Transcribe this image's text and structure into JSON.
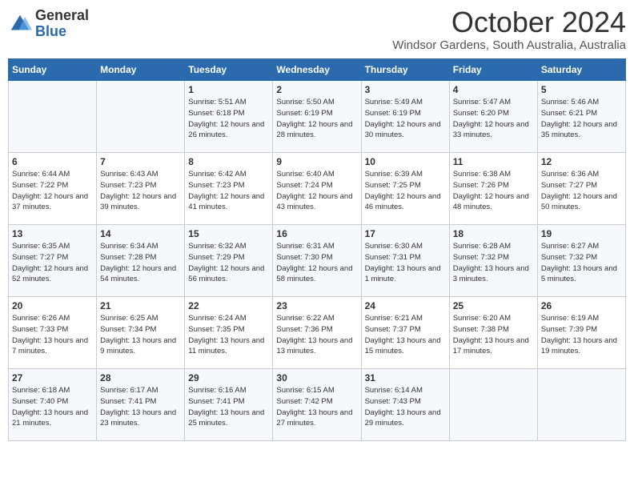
{
  "header": {
    "logo_general": "General",
    "logo_blue": "Blue",
    "month_title": "October 2024",
    "location": "Windsor Gardens, South Australia, Australia"
  },
  "weekdays": [
    "Sunday",
    "Monday",
    "Tuesday",
    "Wednesday",
    "Thursday",
    "Friday",
    "Saturday"
  ],
  "weeks": [
    [
      {
        "day": "",
        "info": ""
      },
      {
        "day": "",
        "info": ""
      },
      {
        "day": "1",
        "info": "Sunrise: 5:51 AM\nSunset: 6:18 PM\nDaylight: 12 hours and 26 minutes."
      },
      {
        "day": "2",
        "info": "Sunrise: 5:50 AM\nSunset: 6:19 PM\nDaylight: 12 hours and 28 minutes."
      },
      {
        "day": "3",
        "info": "Sunrise: 5:49 AM\nSunset: 6:19 PM\nDaylight: 12 hours and 30 minutes."
      },
      {
        "day": "4",
        "info": "Sunrise: 5:47 AM\nSunset: 6:20 PM\nDaylight: 12 hours and 33 minutes."
      },
      {
        "day": "5",
        "info": "Sunrise: 5:46 AM\nSunset: 6:21 PM\nDaylight: 12 hours and 35 minutes."
      }
    ],
    [
      {
        "day": "6",
        "info": "Sunrise: 6:44 AM\nSunset: 7:22 PM\nDaylight: 12 hours and 37 minutes."
      },
      {
        "day": "7",
        "info": "Sunrise: 6:43 AM\nSunset: 7:23 PM\nDaylight: 12 hours and 39 minutes."
      },
      {
        "day": "8",
        "info": "Sunrise: 6:42 AM\nSunset: 7:23 PM\nDaylight: 12 hours and 41 minutes."
      },
      {
        "day": "9",
        "info": "Sunrise: 6:40 AM\nSunset: 7:24 PM\nDaylight: 12 hours and 43 minutes."
      },
      {
        "day": "10",
        "info": "Sunrise: 6:39 AM\nSunset: 7:25 PM\nDaylight: 12 hours and 46 minutes."
      },
      {
        "day": "11",
        "info": "Sunrise: 6:38 AM\nSunset: 7:26 PM\nDaylight: 12 hours and 48 minutes."
      },
      {
        "day": "12",
        "info": "Sunrise: 6:36 AM\nSunset: 7:27 PM\nDaylight: 12 hours and 50 minutes."
      }
    ],
    [
      {
        "day": "13",
        "info": "Sunrise: 6:35 AM\nSunset: 7:27 PM\nDaylight: 12 hours and 52 minutes."
      },
      {
        "day": "14",
        "info": "Sunrise: 6:34 AM\nSunset: 7:28 PM\nDaylight: 12 hours and 54 minutes."
      },
      {
        "day": "15",
        "info": "Sunrise: 6:32 AM\nSunset: 7:29 PM\nDaylight: 12 hours and 56 minutes."
      },
      {
        "day": "16",
        "info": "Sunrise: 6:31 AM\nSunset: 7:30 PM\nDaylight: 12 hours and 58 minutes."
      },
      {
        "day": "17",
        "info": "Sunrise: 6:30 AM\nSunset: 7:31 PM\nDaylight: 13 hours and 1 minute."
      },
      {
        "day": "18",
        "info": "Sunrise: 6:28 AM\nSunset: 7:32 PM\nDaylight: 13 hours and 3 minutes."
      },
      {
        "day": "19",
        "info": "Sunrise: 6:27 AM\nSunset: 7:32 PM\nDaylight: 13 hours and 5 minutes."
      }
    ],
    [
      {
        "day": "20",
        "info": "Sunrise: 6:26 AM\nSunset: 7:33 PM\nDaylight: 13 hours and 7 minutes."
      },
      {
        "day": "21",
        "info": "Sunrise: 6:25 AM\nSunset: 7:34 PM\nDaylight: 13 hours and 9 minutes."
      },
      {
        "day": "22",
        "info": "Sunrise: 6:24 AM\nSunset: 7:35 PM\nDaylight: 13 hours and 11 minutes."
      },
      {
        "day": "23",
        "info": "Sunrise: 6:22 AM\nSunset: 7:36 PM\nDaylight: 13 hours and 13 minutes."
      },
      {
        "day": "24",
        "info": "Sunrise: 6:21 AM\nSunset: 7:37 PM\nDaylight: 13 hours and 15 minutes."
      },
      {
        "day": "25",
        "info": "Sunrise: 6:20 AM\nSunset: 7:38 PM\nDaylight: 13 hours and 17 minutes."
      },
      {
        "day": "26",
        "info": "Sunrise: 6:19 AM\nSunset: 7:39 PM\nDaylight: 13 hours and 19 minutes."
      }
    ],
    [
      {
        "day": "27",
        "info": "Sunrise: 6:18 AM\nSunset: 7:40 PM\nDaylight: 13 hours and 21 minutes."
      },
      {
        "day": "28",
        "info": "Sunrise: 6:17 AM\nSunset: 7:41 PM\nDaylight: 13 hours and 23 minutes."
      },
      {
        "day": "29",
        "info": "Sunrise: 6:16 AM\nSunset: 7:41 PM\nDaylight: 13 hours and 25 minutes."
      },
      {
        "day": "30",
        "info": "Sunrise: 6:15 AM\nSunset: 7:42 PM\nDaylight: 13 hours and 27 minutes."
      },
      {
        "day": "31",
        "info": "Sunrise: 6:14 AM\nSunset: 7:43 PM\nDaylight: 13 hours and 29 minutes."
      },
      {
        "day": "",
        "info": ""
      },
      {
        "day": "",
        "info": ""
      }
    ]
  ]
}
